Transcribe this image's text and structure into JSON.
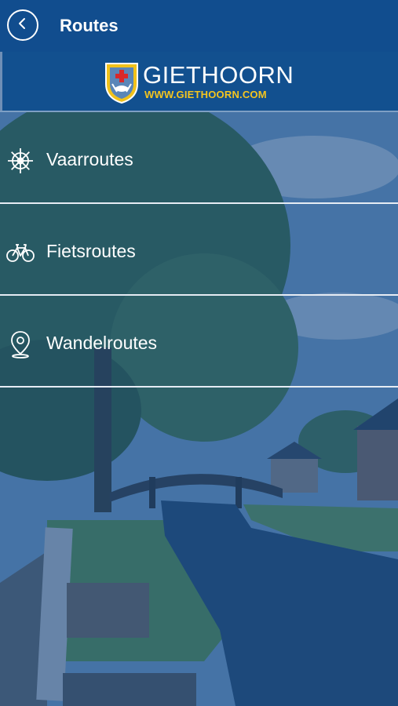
{
  "header": {
    "title": "Routes",
    "back_icon": "chevron-left-icon"
  },
  "logo": {
    "brand": "GIETHOORN",
    "url": "WWW.GIETHOORN.COM"
  },
  "menu": {
    "items": [
      {
        "label": "Vaarroutes",
        "icon": "ship-wheel-icon"
      },
      {
        "label": "Fietsroutes",
        "icon": "bicycle-icon"
      },
      {
        "label": "Wandelroutes",
        "icon": "map-pin-icon"
      }
    ]
  },
  "colors": {
    "appbar": "#114d8e",
    "overlay": "#164887",
    "text": "#ffffff",
    "logo_url": "#f4c51f",
    "divider": "#e6ecf4"
  }
}
